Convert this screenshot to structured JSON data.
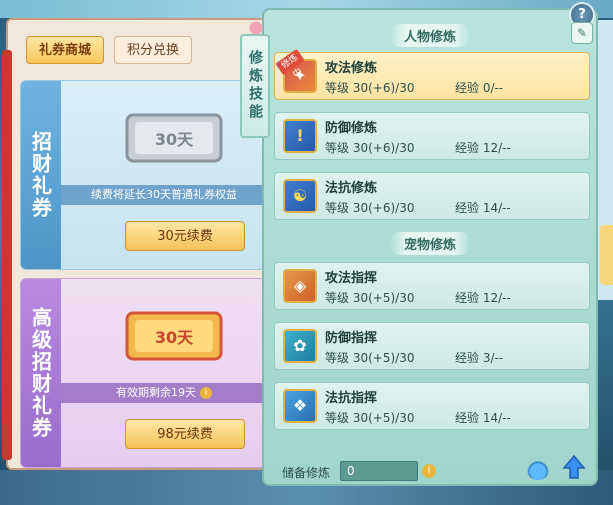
{
  "left_panel": {
    "tabs": [
      "礼券商城",
      "积分兑换"
    ],
    "basic": {
      "label": "招财礼券",
      "ticket_text": "30天",
      "desc": "续费将延长30天普通礼券权益",
      "button": "30元续费"
    },
    "advanced": {
      "label": "高级招财礼券",
      "ticket_text": "30天",
      "desc": "有效期剩余19天",
      "button": "98元续费"
    }
  },
  "vertical_title": "修炼技能",
  "main_panel": {
    "char_section": "人物修炼",
    "pet_section": "宠物修炼",
    "level_label": "等级",
    "exp_label": "经验",
    "active_badge": "修炼中",
    "char_skills": [
      {
        "name": "攻法修炼",
        "level": "30(+6)/30",
        "exp": "0/--",
        "icon": "attack-magic-icon"
      },
      {
        "name": "防御修炼",
        "level": "30(+6)/30",
        "exp": "12/--",
        "icon": "defense-icon"
      },
      {
        "name": "法抗修炼",
        "level": "30(+6)/30",
        "exp": "14/--",
        "icon": "magic-resist-icon"
      }
    ],
    "pet_skills": [
      {
        "name": "攻法指挥",
        "level": "30(+5)/30",
        "exp": "12/--",
        "icon": "pet-attack-icon"
      },
      {
        "name": "防御指挥",
        "level": "30(+5)/30",
        "exp": "3/--",
        "icon": "pet-defense-icon"
      },
      {
        "name": "法抗指挥",
        "level": "30(+5)/30",
        "exp": "14/--",
        "icon": "pet-resist-icon"
      }
    ],
    "store_label": "储备修炼",
    "store_value": "0"
  },
  "colors": {
    "accent_gold": "#f5c45a",
    "panel_teal": "#9fd5cc",
    "badge_red": "#e04a3a"
  }
}
